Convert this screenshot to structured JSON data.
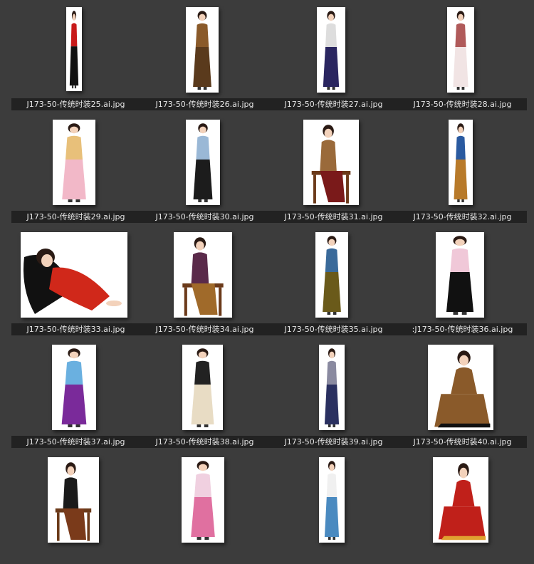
{
  "gallery": {
    "items": [
      {
        "caption": "J173-50-传统时装25.ai.jpg",
        "icon": "woman-black-red-qipao-figure",
        "colors": {
          "main": "#111111",
          "accent": "#c81a1a"
        }
      },
      {
        "caption": "J173-50-传统时装26.ai.jpg",
        "icon": "woman-brown-leopard-qipao-figure",
        "colors": {
          "main": "#5a3a1c",
          "accent": "#8a5a2a"
        }
      },
      {
        "caption": "J173-50-传统时装27.ai.jpg",
        "icon": "woman-navy-qipao-column-figure",
        "colors": {
          "main": "#2a2660",
          "accent": "#dddddd"
        }
      },
      {
        "caption": "J173-50-传统时装28.ai.jpg",
        "icon": "woman-white-lace-qipao-figure",
        "colors": {
          "main": "#f1e4e4",
          "accent": "#b05a5a"
        }
      },
      {
        "caption": "J173-50-传统时装29.ai.jpg",
        "icon": "woman-pink-gown-figure",
        "colors": {
          "main": "#f2b8c8",
          "accent": "#e8c07a"
        }
      },
      {
        "caption": "J173-50-传统时装30.ai.jpg",
        "icon": "woman-blue-jacket-black-skirt-figure",
        "colors": {
          "main": "#1c1c1c",
          "accent": "#9ab8d6"
        }
      },
      {
        "caption": "J173-50-传统时装31.ai.jpg",
        "icon": "woman-seated-chair-figure",
        "colors": {
          "main": "#9a6a3a",
          "accent": "#7a1a1a"
        }
      },
      {
        "caption": "J173-50-传统时装32.ai.jpg",
        "icon": "woman-orange-blue-dress-figure",
        "colors": {
          "main": "#b87a2a",
          "accent": "#2a5aa0"
        }
      },
      {
        "caption": "J173-50-传统时装33.ai.jpg",
        "icon": "woman-reclining-red-robe-figure",
        "colors": {
          "main": "#d0281a",
          "accent": "#111111"
        }
      },
      {
        "caption": "J173-50-传统时装34.ai.jpg",
        "icon": "woman-seated-purple-robe-figure",
        "colors": {
          "main": "#5a2a4a",
          "accent": "#a06a2a"
        }
      },
      {
        "caption": "J173-50-传统时装35.ai.jpg",
        "icon": "woman-olive-jacket-figure",
        "colors": {
          "main": "#6a5a1a",
          "accent": "#3a6a9a"
        }
      },
      {
        "caption": ":J173-50-传统时装36.ai.jpg",
        "icon": "woman-pink-top-black-skirt-figure",
        "colors": {
          "main": "#111111",
          "accent": "#f0c8d8"
        }
      },
      {
        "caption": "J173-50-传统时装37.ai.jpg",
        "icon": "woman-purple-gown-figure",
        "colors": {
          "main": "#7a2a9a",
          "accent": "#6ab0e0"
        }
      },
      {
        "caption": "J173-50-传统时装38.ai.jpg",
        "icon": "woman-flute-beige-robe-figure",
        "colors": {
          "main": "#e8dcc4",
          "accent": "#222222"
        }
      },
      {
        "caption": "J173-50-传统时装39.ai.jpg",
        "icon": "woman-navy-robe-figure",
        "colors": {
          "main": "#2a3060",
          "accent": "#8a8aa0"
        }
      },
      {
        "caption": "J173-50-传统时装40.ai.jpg",
        "icon": "woman-kneeling-brown-robe-figure",
        "colors": {
          "main": "#8a5a2a",
          "accent": "#111111"
        }
      },
      {
        "caption": "",
        "icon": "woman-seated-black-qipao-figure",
        "colors": {
          "main": "#1a1a1a",
          "accent": "#7a3a1a"
        }
      },
      {
        "caption": "",
        "icon": "woman-pink-floral-robe-figure",
        "colors": {
          "main": "#e070a0",
          "accent": "#f0d0e0"
        }
      },
      {
        "caption": "",
        "icon": "woman-blue-white-qipao-figure",
        "colors": {
          "main": "#4a8ac0",
          "accent": "#f0f0f0"
        }
      },
      {
        "caption": "",
        "icon": "woman-red-robe-mirror-figure",
        "colors": {
          "main": "#c0201a",
          "accent": "#e0a030"
        }
      }
    ]
  }
}
